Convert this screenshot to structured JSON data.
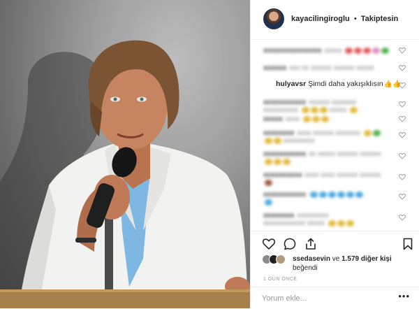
{
  "header": {
    "username": "kayacilingiroglu",
    "separator": "•",
    "follow_status": "Takiptesin"
  },
  "comments": {
    "featured": {
      "username": "hulyavsr",
      "text": "Şimdi daha yakışıklısın",
      "emoji": "👍👍"
    }
  },
  "likes": {
    "first_user": "ssedasevin",
    "middle": " ve ",
    "count_text": "1.579 diğer kişi",
    "suffix": "beğendi"
  },
  "timestamp": "1 GÜN ÖNCE",
  "comment_input": {
    "placeholder": "Yorum ekle..."
  },
  "more_icon": "•••",
  "colors": {
    "text": "#262626",
    "muted": "#999999",
    "border": "#efefef"
  },
  "icons": [
    "heart-icon",
    "comment-icon",
    "share-icon",
    "bookmark-icon",
    "more-icon"
  ]
}
